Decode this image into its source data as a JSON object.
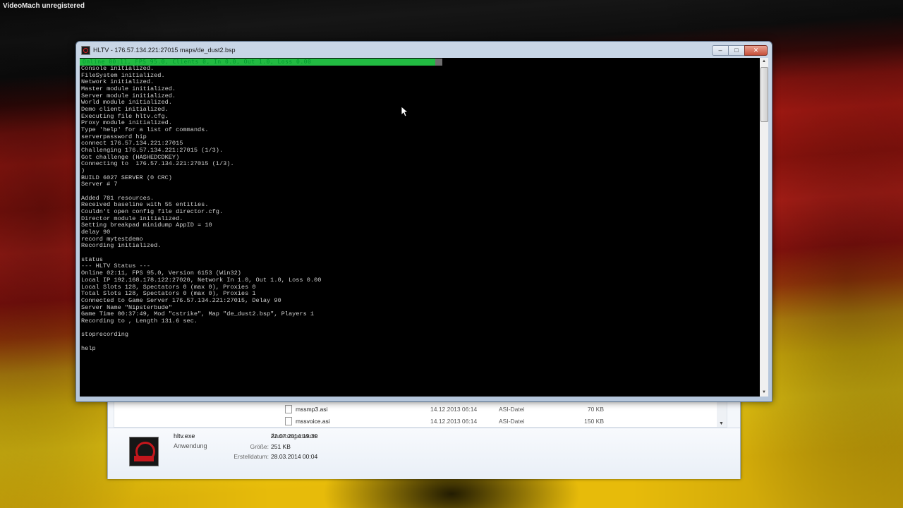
{
  "watermark": "VideoMach unregistered",
  "hltv": {
    "title": "HLTV - 176.57.134.221:27015 maps/de_dust2.bsp",
    "buttons": {
      "minimize": "–",
      "maximize": "□",
      "close": "✕"
    },
    "status_line": "Online 00:11, FPS 95.0, Clients 0, In 0.0, Out 1.0, Loss 0.00",
    "lines": [
      "Console initialized.",
      "FileSystem initialized.",
      "Network initialized.",
      "Master module initialized.",
      "Server module initialized.",
      "World module initialized.",
      "Demo client initialized.",
      "Executing file hltv.cfg.",
      "Proxy module initialized.",
      "Type 'help' for a list of commands.",
      "serverpassword hip",
      "connect 176.57.134.221:27015",
      "Challenging 176.57.134.221:27015 (1/3).",
      "Got challenge (HASHEDCDKEY)",
      "Connecting to  176.57.134.221:27015 (1/3).",
      ")",
      "BUILD 6027 SERVER (0 CRC)",
      "Server # 7",
      "",
      "Added 781 resources.",
      "Received baseline with 55 entities.",
      "Couldn't open config file director.cfg.",
      "Director module initialized.",
      "Setting breakpad minidump AppID = 10",
      "delay 90",
      "record mytestdemo",
      "Recording initialized.",
      "",
      "status",
      "--- HLTV Status ---",
      "Online 02:11, FPS 95.0, Version 6153 (Win32)",
      "Local IP 192.168.178.122:27020, Network In 1.0, Out 1.0, Loss 0.00",
      "Local Slots 128, Spectators 0 (max 0), Proxies 0",
      "Total Slots 128, Spectators 0 (max 0), Proxies 1",
      "Connected to Game Server 176.57.134.221:27015, Delay 90",
      "Server Name \"Nipsterbude\"",
      "Game Time 00:37:49, Mod \"cstrike\", Map \"de_dust2.bsp\", Players 1",
      "Recording to , Length 131.6 sec.",
      "",
      "stoprecording",
      "",
      "help"
    ]
  },
  "explorer": {
    "files": [
      {
        "name": "mssmp3.asi",
        "date": "14.12.2013 06:14",
        "type": "ASI-Datei",
        "size": "70 KB"
      },
      {
        "name": "mssvoice.asi",
        "date": "14.12.2013 06:14",
        "type": "ASI-Datei",
        "size": "150 KB"
      }
    ],
    "details": {
      "name": "hltv.exe",
      "type": "Anwendung",
      "modified_label": "Änderungsdatum:",
      "modified_value": "22.07.2014 19:39",
      "size_label": "Größe:",
      "size_value": "251 KB",
      "created_label": "Erstelldatum:",
      "created_value": "28.03.2014 00:04"
    }
  }
}
